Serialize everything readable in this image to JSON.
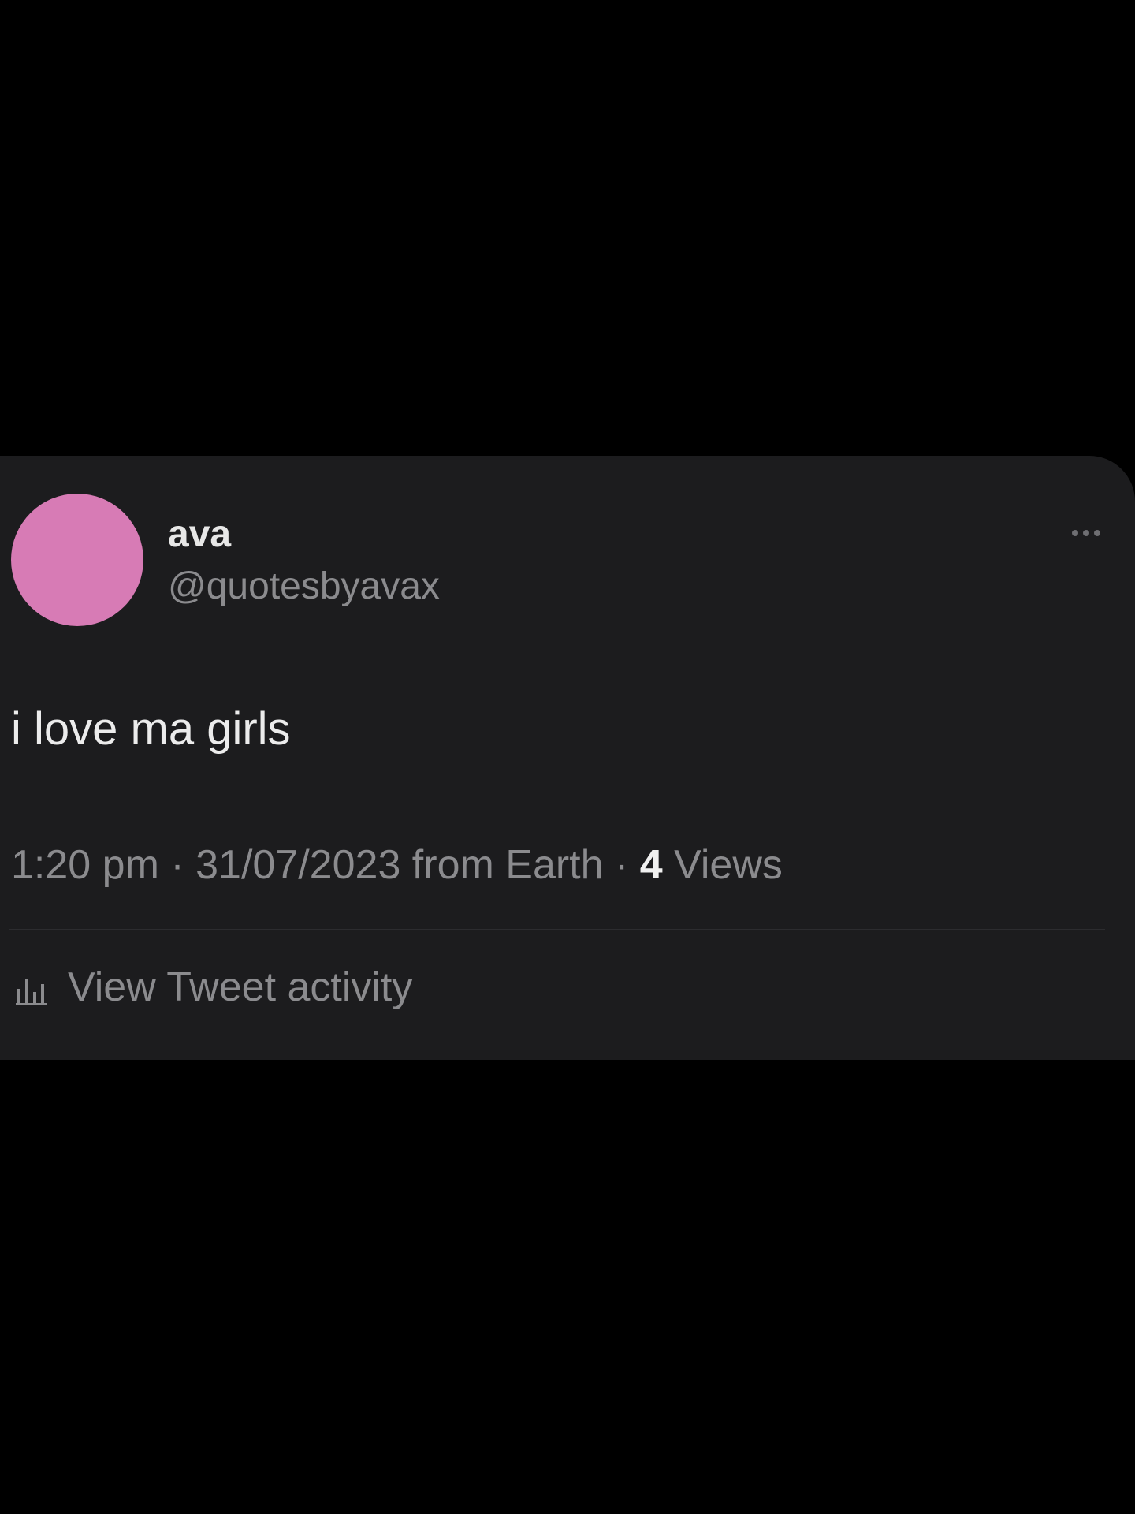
{
  "colors": {
    "page_background": "#000000",
    "card_background": "#1c1c1e",
    "avatar": "#d77bb5",
    "primary_text": "#ececec",
    "secondary_text": "#8b8b8e"
  },
  "tweet": {
    "author": {
      "display_name": "ava",
      "handle": "@quotesbyavax"
    },
    "more_icon": "more-horizontal-icon",
    "text": "i love ma girls",
    "meta": {
      "time": "1:20 pm",
      "separator_1": " · ",
      "date_location": "31/07/2023 from Earth",
      "separator_2": " · ",
      "views_count": "4",
      "views_label": " Views"
    },
    "activity": {
      "icon": "bar-chart-icon",
      "label": "View Tweet activity"
    }
  }
}
